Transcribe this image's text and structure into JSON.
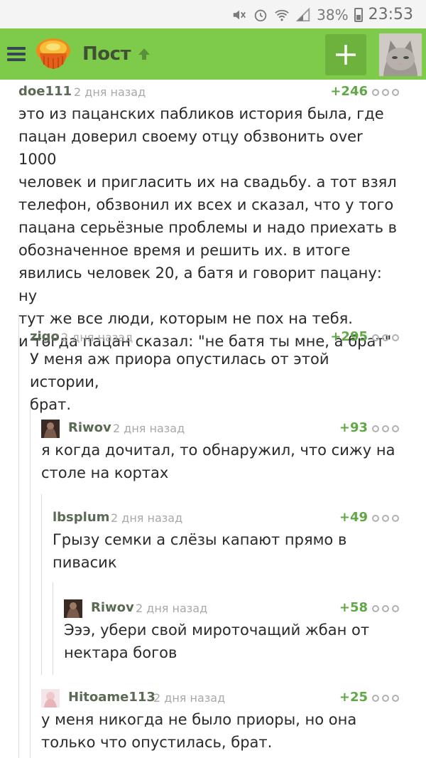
{
  "status_bar": {
    "battery": "38%",
    "time": "23:53",
    "icons": [
      "mute-icon",
      "alarm-icon",
      "wifi-icon",
      "signal-icon",
      "battery-icon"
    ]
  },
  "app_bar": {
    "title": "Пост",
    "menu_icon": "hamburger-menu-icon",
    "logo": "pikabu-logo",
    "add_button": "+",
    "colors": {
      "bar": "#7ecb4b",
      "add": "#6cb23d",
      "title": "#3f5035"
    }
  },
  "comments": [
    {
      "author": "doe111",
      "date": "2 дня назад",
      "rating": "+246",
      "text": "это из пацанских пабликов история была, где\n пацан доверил своему отцу обзвонить over 1000\nчеловек и пригласить их на свадьбу. а тот взял\nтелефон, обзвонил их всех и сказал, что у того\nпацана серьёзные проблемы и надо приехать в\nобозначенное время и решить их. в итоге\nявились человек 20, а батя и говорит пацану: ну\nтут же все люди, которым не пох на тебя.\nи тогда пацан сказал: \"не батя ты мне, а брат\""
    },
    {
      "author": "zigo",
      "date": "2 дня назад",
      "rating": "+295",
      "text": "У меня аж приора опустилась от этой истории,\nбрат."
    },
    {
      "author": "Riwov",
      "date": "2 дня назад",
      "rating": "+93",
      "text": "я когда дочитал, то обнаружил, что сижу на\nстоле на кортах"
    },
    {
      "author": "lbsplum",
      "date": "2 дня назад",
      "rating": "+49",
      "text": "Грызу семки а слёзы капают прямо в\nпивасик"
    },
    {
      "author": "Riwov",
      "date": "2 дня назад",
      "rating": "+58",
      "text": "Эээ, убери свой мироточащий жбан от\nнектара богов"
    },
    {
      "author": "Hitoame113",
      "date": "2 дня назад",
      "rating": "+25",
      "text": "у меня никогда не было приоры, но она\nтолько что опустилась, брат."
    }
  ]
}
